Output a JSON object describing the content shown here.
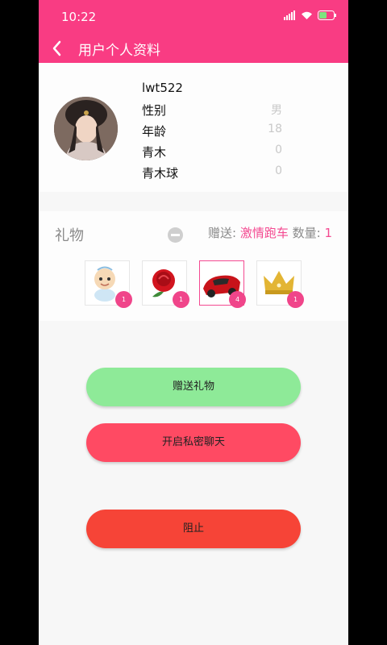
{
  "status_bar": {
    "time": "10:22"
  },
  "toolbar": {
    "title": "用户个人资料"
  },
  "profile": {
    "username": "lwt522",
    "fields": [
      {
        "label": "性别",
        "value": "男"
      },
      {
        "label": "年龄",
        "value": "18"
      },
      {
        "label": "青木",
        "value": "0"
      },
      {
        "label": "青木球",
        "value": "0"
      }
    ]
  },
  "gifts": {
    "title": "礼物",
    "send_label": "赠送:",
    "selected_gift": "激情跑车",
    "quantity_label": "数量:",
    "quantity": "1",
    "items": [
      {
        "name": "baby",
        "count": "1"
      },
      {
        "name": "rose",
        "count": "1"
      },
      {
        "name": "sports-car",
        "count": "4"
      },
      {
        "name": "crown",
        "count": "1"
      }
    ]
  },
  "buttons": {
    "send_gift": "赠送礼物",
    "private_chat": "开启私密聊天",
    "block": "阻止"
  },
  "colors": {
    "primary": "#f93c83",
    "send_button": "#8eea98",
    "chat_button": "#ff4a63",
    "block_button": "#f64437"
  }
}
